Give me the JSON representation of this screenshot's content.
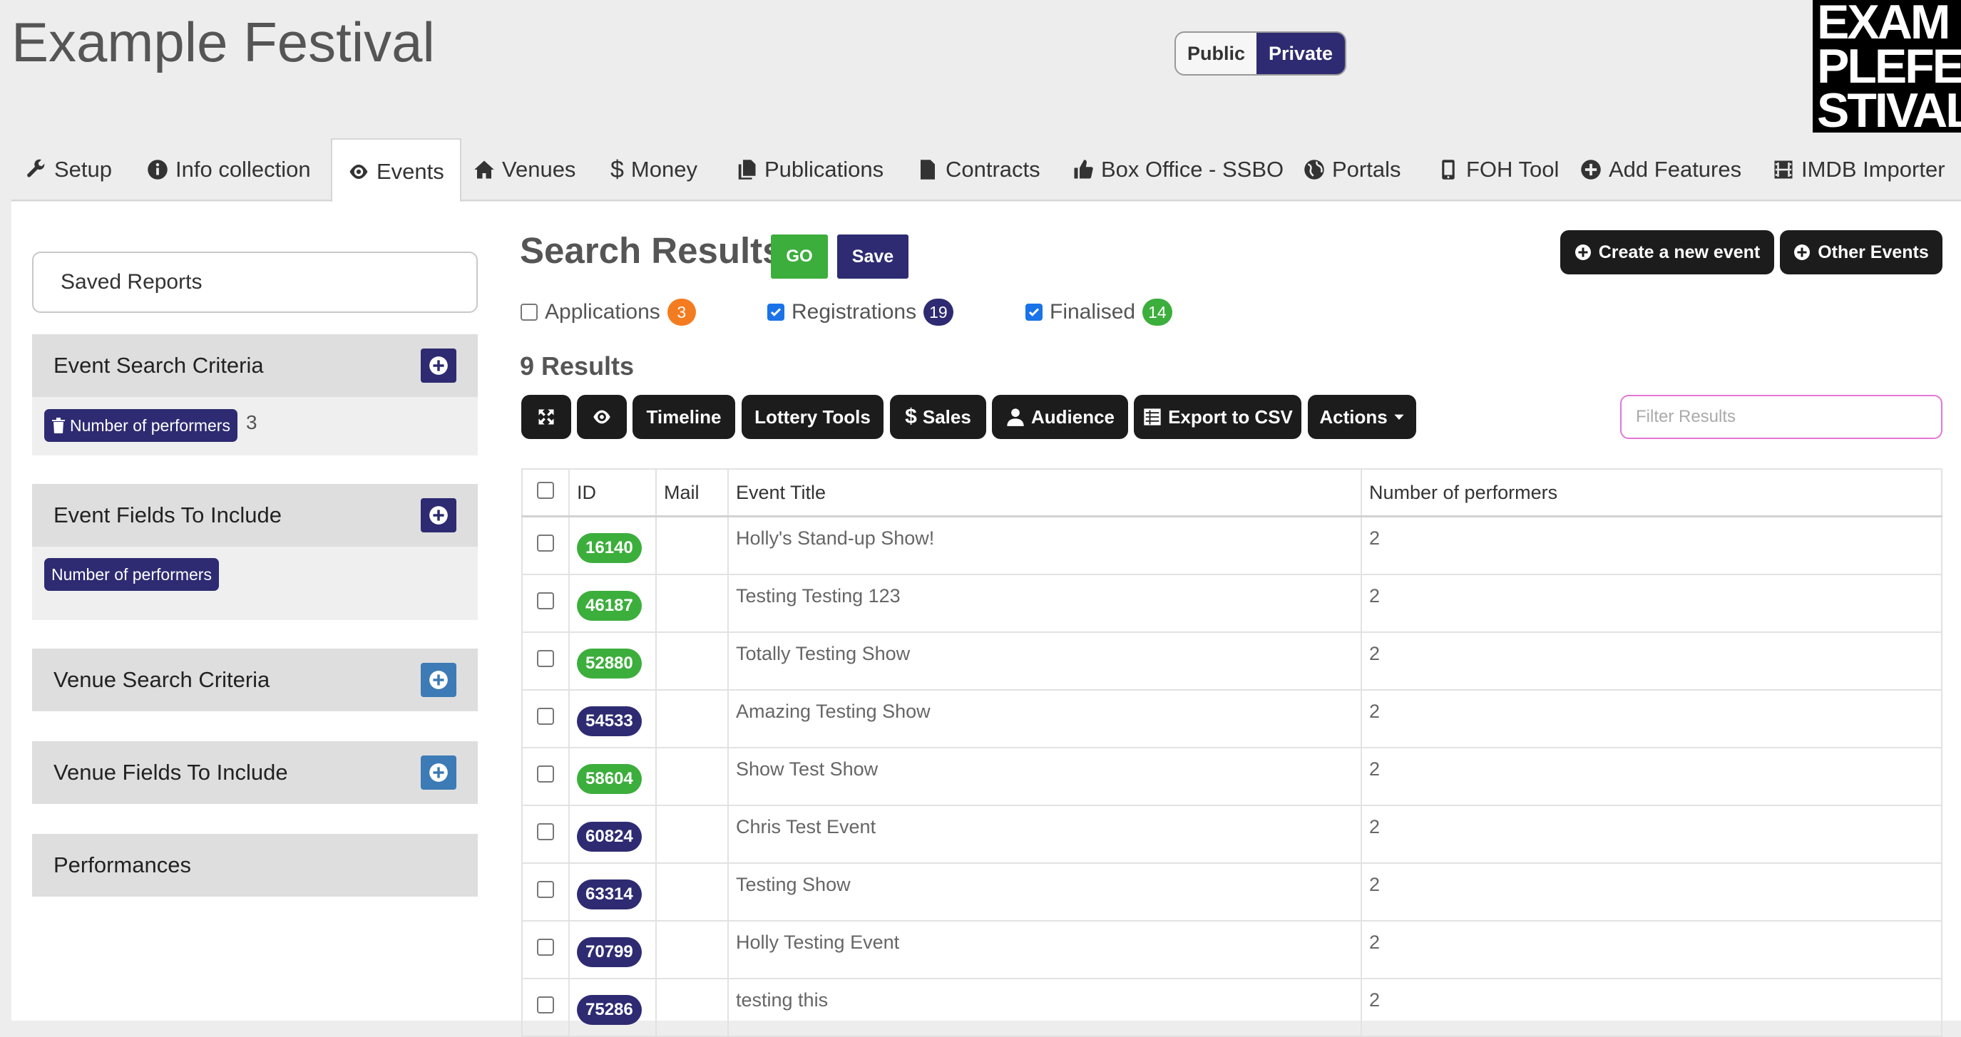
{
  "header": {
    "title": "Example Festival",
    "visibility": {
      "public": "Public",
      "private": "Private",
      "selected": "Private"
    },
    "logo_lines": [
      "EXAM",
      "PLEFE",
      "STIVAL"
    ]
  },
  "tabs": [
    {
      "label": "Setup",
      "icon": "wrench-icon"
    },
    {
      "label": "Info collection",
      "icon": "info-icon"
    },
    {
      "label": "Events",
      "icon": "eye-icon",
      "active": true
    },
    {
      "label": "Venues",
      "icon": "home-icon"
    },
    {
      "label": "Money",
      "icon": "dollar-icon"
    },
    {
      "label": "Publications",
      "icon": "files-icon"
    },
    {
      "label": "Contracts",
      "icon": "file-icon"
    },
    {
      "label": "Box Office - SSBO",
      "icon": "thumbs-up-icon"
    },
    {
      "label": "Portals",
      "icon": "globe-icon"
    },
    {
      "label": "FOH Tool",
      "icon": "phone-icon"
    },
    {
      "label": "Add Features",
      "icon": "plus-circle-icon"
    },
    {
      "label": "IMDB Importer",
      "icon": "film-icon"
    }
  ],
  "sidebar": {
    "saved_reports": "Saved Reports",
    "event_search_criteria": {
      "title": "Event Search Criteria",
      "chip": "Number of performers",
      "value": "3"
    },
    "event_fields": {
      "title": "Event Fields To Include",
      "chip": "Number of performers"
    },
    "venue_search_criteria": "Venue Search Criteria",
    "venue_fields": "Venue Fields To Include",
    "performances": "Performances"
  },
  "main": {
    "title": "Search Results",
    "go_label": "GO",
    "save_label": "Save",
    "create_event": "Create a new event",
    "other_events": "Other Events",
    "filters": [
      {
        "label": "Applications",
        "count": "3",
        "checked": false,
        "color": "#f47c20"
      },
      {
        "label": "Registrations",
        "count": "19",
        "checked": true,
        "color": "#2e2b72"
      },
      {
        "label": "Finalised",
        "count": "14",
        "checked": true,
        "color": "#3cae3c"
      }
    ],
    "results_count": "9 Results",
    "toolbar": {
      "timeline": "Timeline",
      "lottery_tools": "Lottery Tools",
      "sales": "Sales",
      "audience": "Audience",
      "export_csv": "Export to CSV",
      "actions": "Actions"
    },
    "filter_placeholder": "Filter Results"
  },
  "table": {
    "columns": [
      "ID",
      "Mail",
      "Event Title",
      "Number of performers"
    ],
    "rows": [
      {
        "id": "16140",
        "status": "green",
        "title": "Holly's Stand-up Show!",
        "performers": "2"
      },
      {
        "id": "46187",
        "status": "green",
        "title": "Testing Testing 123",
        "performers": "2"
      },
      {
        "id": "52880",
        "status": "green",
        "title": "Totally Testing Show",
        "performers": "2"
      },
      {
        "id": "54533",
        "status": "navy",
        "title": "Amazing Testing Show",
        "performers": "2"
      },
      {
        "id": "58604",
        "status": "green",
        "title": "Show Test Show",
        "performers": "2"
      },
      {
        "id": "60824",
        "status": "navy",
        "title": "Chris Test Event",
        "performers": "2"
      },
      {
        "id": "63314",
        "status": "navy",
        "title": "Testing Show",
        "performers": "2"
      },
      {
        "id": "70799",
        "status": "navy",
        "title": "Holly Testing Event",
        "performers": "2"
      },
      {
        "id": "75286",
        "status": "navy",
        "title": "testing this",
        "performers": "2"
      }
    ]
  },
  "colors": {
    "navy": "#2e2b72",
    "green": "#3cae3c",
    "orange": "#f47c20",
    "dark": "#1c1c1c"
  }
}
